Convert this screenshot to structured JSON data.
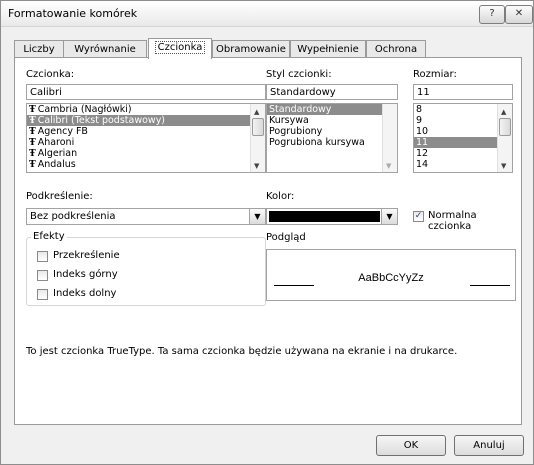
{
  "window": {
    "title": "Formatowanie komórek",
    "help_label": "?",
    "close_label": "✕"
  },
  "tabs": [
    {
      "label": "Liczby"
    },
    {
      "label": "Wyrównanie"
    },
    {
      "label": "Czcionka"
    },
    {
      "label": "Obramowanie"
    },
    {
      "label": "Wypełnienie"
    },
    {
      "label": "Ochrona"
    }
  ],
  "active_tab": "Czcionka",
  "font": {
    "label": "Czcionka:",
    "value": "Calibri",
    "items": [
      {
        "label": "Cambria (Nagłówki)"
      },
      {
        "label": "Calibri (Tekst podstawowy)"
      },
      {
        "label": "Agency FB"
      },
      {
        "label": "Aharoni"
      },
      {
        "label": "Algerian"
      },
      {
        "label": "Andalus"
      }
    ],
    "selected": "Calibri (Tekst podstawowy)",
    "item_icon": "truetype-icon",
    "icon_glyph": "Ŧ"
  },
  "style": {
    "label": "Styl czcionki:",
    "value": "Standardowy",
    "items": [
      {
        "label": "Standardowy"
      },
      {
        "label": "Kursywa"
      },
      {
        "label": "Pogrubiony"
      },
      {
        "label": "Pogrubiona kursywa"
      }
    ],
    "selected": "Standardowy"
  },
  "size": {
    "label": "Rozmiar:",
    "value": "11",
    "items": [
      {
        "label": "8"
      },
      {
        "label": "9"
      },
      {
        "label": "10"
      },
      {
        "label": "11"
      },
      {
        "label": "12"
      },
      {
        "label": "14"
      }
    ],
    "selected": "11"
  },
  "underline": {
    "label": "Podkreślenie:",
    "value": "Bez podkreślenia"
  },
  "color": {
    "label": "Kolor:",
    "value_color": "#000000"
  },
  "normal_font": {
    "label": "Normalna czcionka",
    "checked": true
  },
  "effects": {
    "title": "Efekty",
    "strikethrough": "Przekreślenie",
    "superscript": "Indeks górny",
    "subscript": "Indeks dolny"
  },
  "preview": {
    "title": "Podgląd",
    "sample": "AaBbCcYyZz"
  },
  "info_text": "To jest czcionka TrueType. Ta sama czcionka będzie używana na ekranie i na drukarce.",
  "buttons": {
    "ok": "OK",
    "cancel": "Anuluj"
  },
  "icons": {
    "dropdown_arrow": "▼",
    "scroll_up": "▲",
    "scroll_down": "▼",
    "check_mark": "✓"
  },
  "colors": {
    "selection": "#8c8c8c"
  }
}
